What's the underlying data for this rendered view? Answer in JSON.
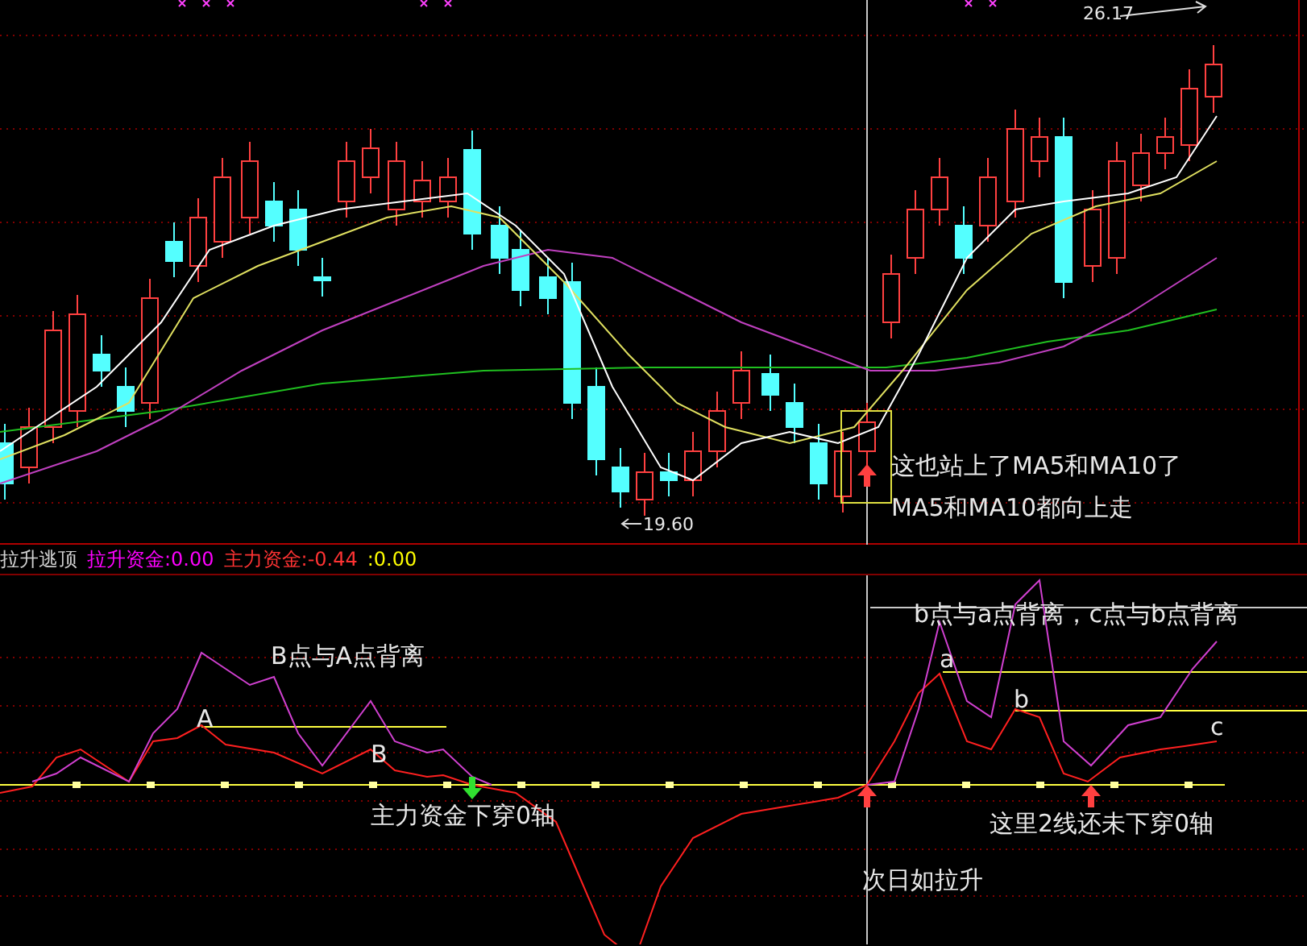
{
  "price_chart": {
    "high_label": "26.17",
    "low_label": "19.60",
    "annotations": [
      {
        "text": "这也站上了MA5和MA10了"
      },
      {
        "text": "MA5和MA10都向上走"
      }
    ]
  },
  "indicator": {
    "name": "拉升逃顶",
    "fields": [
      {
        "label": "拉升资金:",
        "value": "0.00",
        "kind": "pull"
      },
      {
        "label": "主力资金:",
        "value": "-0.44",
        "kind": "main"
      },
      {
        "label": ":",
        "value": "0.00",
        "kind": "plain"
      }
    ],
    "annotations": [
      {
        "text": "B点与A点背离"
      },
      {
        "text": "A"
      },
      {
        "text": "B"
      },
      {
        "text": "主力资金下穿0轴"
      },
      {
        "text": "b点与a点背离，c点与b点背离"
      },
      {
        "text": "a"
      },
      {
        "text": "b"
      },
      {
        "text": "c"
      },
      {
        "text": "这里2线还未下穿0轴"
      },
      {
        "text": "次日如拉升"
      }
    ]
  }
}
